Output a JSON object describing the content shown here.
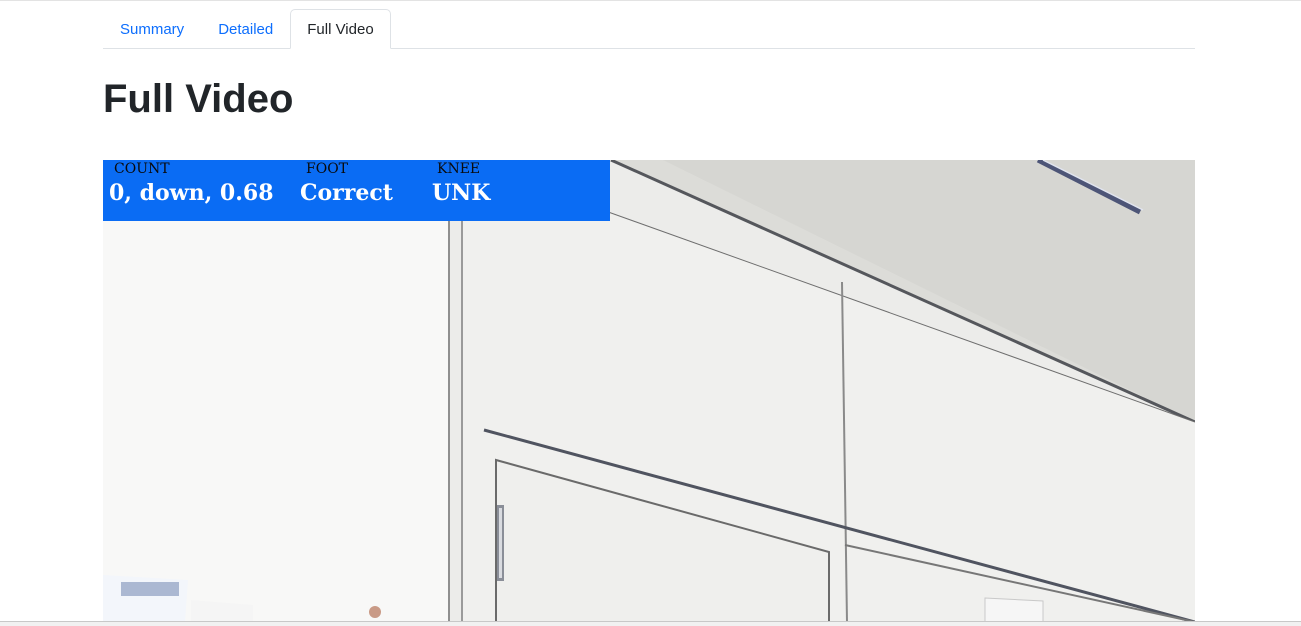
{
  "tabs": [
    {
      "label": "Summary",
      "active": false
    },
    {
      "label": "Detailed",
      "active": false
    },
    {
      "label": "Full Video",
      "active": true
    }
  ],
  "page": {
    "title": "Full Video"
  },
  "video": {
    "overlay": {
      "count_label": "COUNT",
      "count_value": "0, down, 0.68",
      "foot_label": "FOOT",
      "foot_value": "Correct",
      "knee_label": "KNEE",
      "knee_value": "UNK",
      "background_color": "#0a6cf4"
    }
  },
  "colors": {
    "link": "#0d6efd",
    "text": "#212529"
  }
}
